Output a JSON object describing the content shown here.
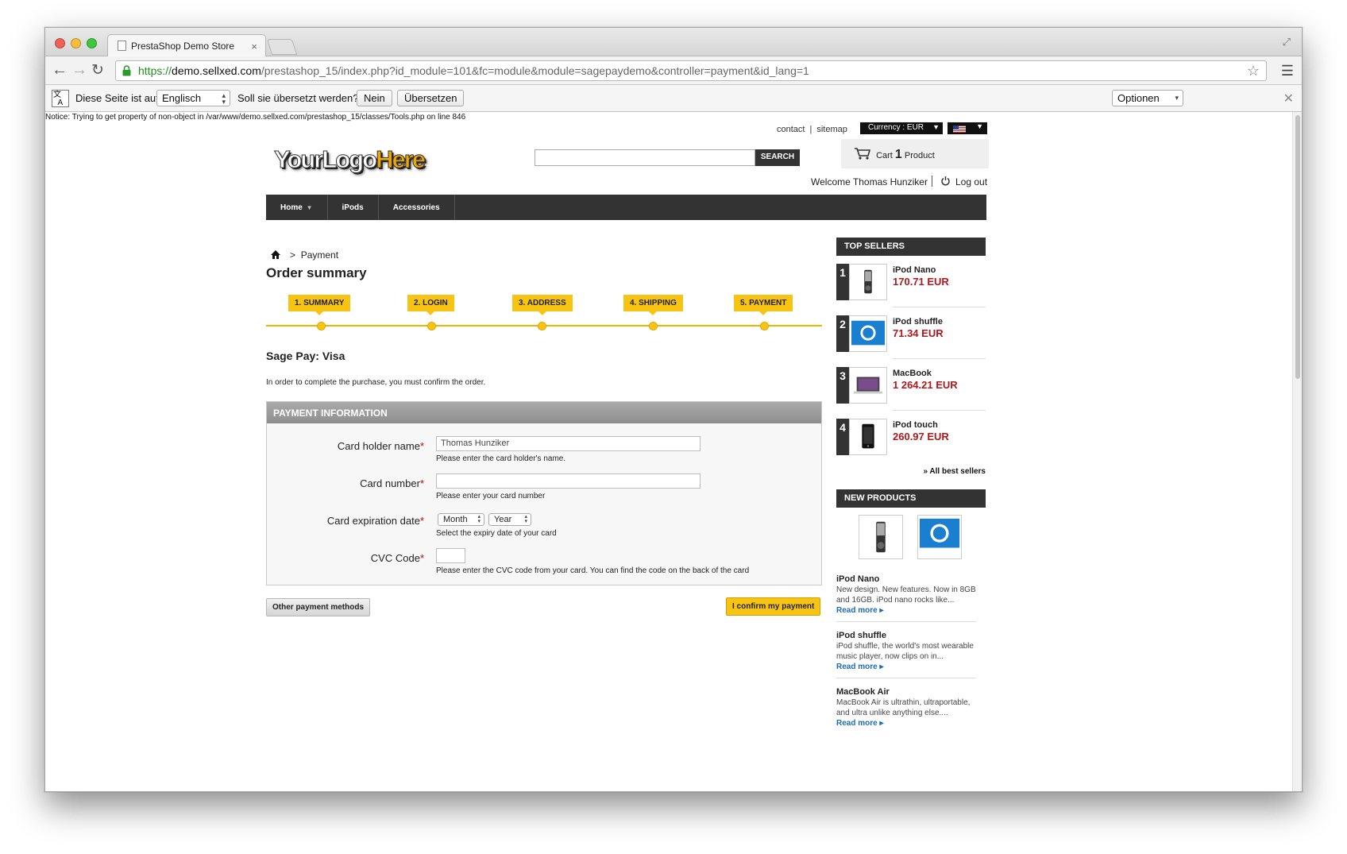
{
  "browser": {
    "tab_title": "PrestaShop Demo Store",
    "tab_close": "×",
    "url_scheme": "https://",
    "url_host": "demo.sellxed.com",
    "url_path": "/prestashop_15/index.php?id_module=101&fc=module&module=sagepaydemo&controller=payment&id_lang=1"
  },
  "translate_bar": {
    "intro": "Diese Seite ist auf",
    "language": "Englisch",
    "question": "Soll sie übersetzt werden?",
    "no_label": "Nein",
    "translate_label": "Übersetzen",
    "options_label": "Optionen"
  },
  "notice": "Notice: Trying to get property of non-object in /var/www/demo.sellxed.com/prestashop_15/classes/Tools.php on line 846",
  "header": {
    "contact": "contact",
    "sitemap": "sitemap",
    "link_separator": "|",
    "currency": "Currency : EUR",
    "logo_part1": "YourLogo",
    "logo_part2": "Here",
    "search_button": "SEARCH",
    "search_value": "",
    "cart_label": "Cart",
    "cart_qty": "1",
    "cart_unit": "Product",
    "welcome": "Welcome Thomas Hunziker",
    "logout": "Log out"
  },
  "nav": {
    "home": "Home",
    "ipods": "iPods",
    "accessories": "Accessories"
  },
  "breadcrumb": {
    "separator": ">",
    "current": "Payment"
  },
  "order": {
    "title": "Order summary",
    "steps": [
      "1. SUMMARY",
      "2. LOGIN",
      "3. ADDRESS",
      "4. SHIPPING",
      "5. PAYMENT"
    ],
    "method_title": "Sage Pay: Visa",
    "confirm_text": "In order to complete the purchase, you must confirm the order."
  },
  "payment_form": {
    "heading": "PAYMENT INFORMATION",
    "required_mark": "*",
    "holder_label": "Card holder name",
    "holder_value": "Thomas Hunziker",
    "holder_hint": "Please enter the card holder's name.",
    "number_label": "Card number",
    "number_value": "",
    "number_hint": "Please enter your card number",
    "expiry_label": "Card expiration date",
    "month": "Month",
    "year": "Year",
    "expiry_hint": "Select the expiry date of your card",
    "cvc_label": "CVC Code",
    "cvc_value": "",
    "cvc_hint": "Please enter the CVC code from your card. You can find the code on the back of the card"
  },
  "actions": {
    "other_methods": "Other payment methods",
    "confirm": "I confirm my payment"
  },
  "sidebar": {
    "top_sellers_title": "TOP SELLERS",
    "top_sellers": [
      {
        "rank": "1",
        "name": "iPod Nano",
        "price": "170.71 EUR"
      },
      {
        "rank": "2",
        "name": "iPod shuffle",
        "price": "71.34 EUR"
      },
      {
        "rank": "3",
        "name": "MacBook",
        "price": "1 264.21 EUR"
      },
      {
        "rank": "4",
        "name": "iPod touch",
        "price": "260.97 EUR"
      }
    ],
    "all_best_sellers": "» All best sellers",
    "new_products_title": "NEW PRODUCTS",
    "new_products": [
      {
        "name": "iPod Nano",
        "desc": "New design. New features. Now in 8GB and 16GB. iPod nano rocks like...",
        "more": "Read more ▸"
      },
      {
        "name": "iPod shuffle",
        "desc": "iPod shuffle, the world's most wearable music player, now clips on in...",
        "more": "Read more ▸"
      },
      {
        "name": "MacBook Air",
        "desc": "MacBook Air is ultrathin, ultraportable, and ultra unlike anything else....",
        "more": "Read more ▸"
      }
    ]
  },
  "colors": {
    "accent": "#f8c414",
    "price": "#b3171b",
    "dark": "#333333",
    "link": "#1d6bb8"
  }
}
